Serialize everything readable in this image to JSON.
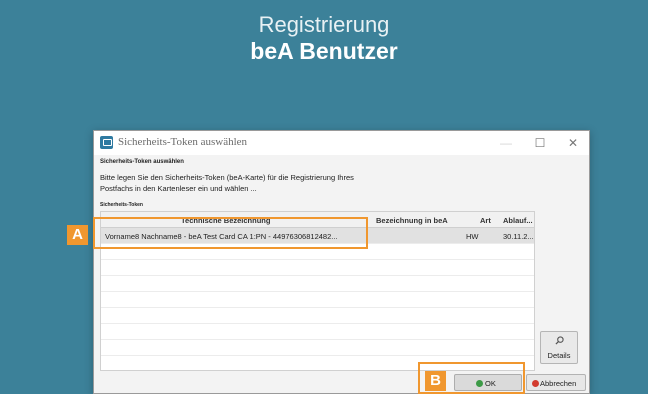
{
  "page": {
    "heading_line1": "Registrierung",
    "heading_line2": "beA Benutzer"
  },
  "dialog": {
    "title": "Sicherheits-Token auswählen",
    "section_title": "Sicherheits-Token auswählen",
    "instructions": "Bitte legen Sie den Sicherheits-Token (beA-Karte) für die Registrierung Ihres Postfachs in den Kartenleser ein und wählen ...",
    "list_caption": "Sicherheits-Token",
    "window_buttons": {
      "minimize": "—",
      "maximize": "☐",
      "close": "✕"
    },
    "table": {
      "columns": [
        "Technische Bezeichnung",
        "Bezeichnung in beA",
        "Art",
        "Ablauf..."
      ],
      "rows": [
        {
          "name": "Vorname8 Nachname8 - beA Test Card CA 1:PN - 44976306812482...",
          "bea": "",
          "art": "HW",
          "ablauf": "30.11.2..."
        }
      ]
    },
    "details_label": "Details",
    "ok_label": "OK",
    "cancel_label": "Abbrechen"
  },
  "markers": {
    "a": "A",
    "b": "B"
  },
  "colors": {
    "background": "#3c8199",
    "highlight": "#f0972f",
    "ok_icon": "#3c9a46",
    "cancel_icon": "#d23b2f"
  },
  "icons": {
    "app": "app-window-icon",
    "details": "magnifier-icon",
    "ok": "green-check-icon",
    "cancel": "red-cancel-icon"
  }
}
